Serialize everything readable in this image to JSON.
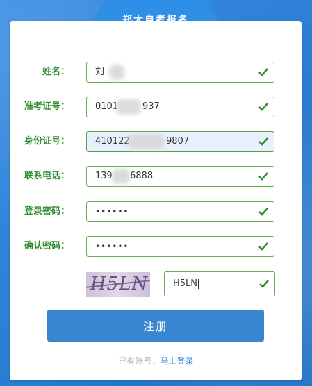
{
  "form": {
    "title": "郑大自考报名",
    "fields": [
      {
        "label": "姓名：",
        "value": "刘"
      },
      {
        "label": "准考证号：",
        "value": "0101",
        "value_suffix": "937"
      },
      {
        "label": "身份证号：",
        "value": "410122",
        "value_suffix": "9807"
      },
      {
        "label": "联系电话：",
        "value": "139",
        "value_suffix": "6888"
      },
      {
        "label": "登录密码：",
        "value": "••••••"
      },
      {
        "label": "确认密码：",
        "value": "••••••"
      }
    ],
    "captcha": {
      "image_text": "H5LN",
      "input_value": "H5LN"
    },
    "submit_label": "注册",
    "footer": {
      "text": "已有账号，",
      "link": "马上登录"
    }
  },
  "colors": {
    "accent": "#2f8fe6",
    "label_green": "#2e8b2e",
    "check_green": "#2e8b2e",
    "button": "#3a85cf"
  },
  "icons": {
    "field_status": "check-icon"
  }
}
